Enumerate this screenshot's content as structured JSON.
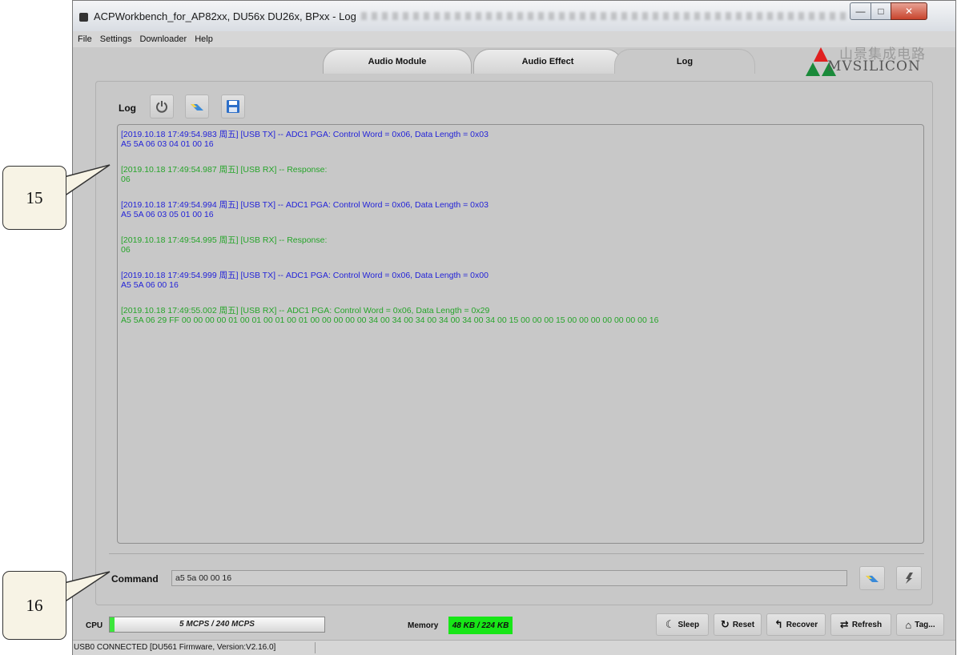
{
  "window": {
    "title": "ACPWorkbench_for_AP82xx, DU56x DU26x, BPxx - Log",
    "controls": {
      "minimize": "—",
      "maximize": "□",
      "close": "✕"
    }
  },
  "menu": [
    "File",
    "Settings",
    "Downloader",
    "Help"
  ],
  "logo": {
    "cn": "山景集成电路",
    "en": "MVSILICON"
  },
  "tabs": {
    "audio_module": "Audio Module",
    "audio_effect": "Audio Effect",
    "log": "Log"
  },
  "log_panel": {
    "label": "Log",
    "entries": [
      {
        "kind": "tx",
        "header": "[2019.10.18 17:49:54.983 周五] [USB TX] -- ADC1 PGA:  Control Word = 0x06,  Data Length = 0x03",
        "data": "A5 5A 06 03 04 01 00 16"
      },
      {
        "kind": "rx",
        "header": "[2019.10.18 17:49:54.987 周五] [USB RX] -- Response:",
        "data": "06"
      },
      {
        "kind": "tx",
        "header": "[2019.10.18 17:49:54.994 周五] [USB TX] -- ADC1 PGA:  Control Word = 0x06,  Data Length = 0x03",
        "data": "A5 5A 06 03 05 01 00 16"
      },
      {
        "kind": "rx",
        "header": "[2019.10.18 17:49:54.995 周五] [USB RX] -- Response:",
        "data": "06"
      },
      {
        "kind": "tx",
        "header": "[2019.10.18 17:49:54.999 周五] [USB TX] -- ADC1 PGA:  Control Word = 0x06,  Data Length = 0x00",
        "data": "A5 5A 06 00 16"
      },
      {
        "kind": "rx",
        "header": "[2019.10.18 17:49:55.002 周五] [USB RX] -- ADC1 PGA:  Control Word = 0x06,  Data Length = 0x29",
        "data": "A5 5A 06 29 FF 00 00 00 00 01 00 01 00 01 00 01 00 00 00 00 00 34 00 34 00 34 00 34 00 34 00 34 00 15 00 00 00 15 00 00 00 00 00 00 00 16"
      }
    ]
  },
  "command": {
    "label": "Command",
    "value": "a5 5a 00 00 16"
  },
  "status": {
    "cpu_label": "CPU",
    "cpu_value": "5 MCPS / 240 MCPS",
    "cpu_fraction": 0.021,
    "memory_label": "Memory",
    "memory_value": "48 KB / 224 KB"
  },
  "buttons": {
    "sleep": "Sleep",
    "reset": "Reset",
    "recover": "Recover",
    "refresh": "Refresh",
    "tag": "Tag..."
  },
  "statusbar": {
    "text": "USB0 CONNECTED [DU561 Firmware, Version:V2.16.0]"
  },
  "callouts": {
    "c15": "15",
    "c16": "16"
  },
  "colors": {
    "tx": "#2323d8",
    "rx": "#26a42a",
    "memory_fill": "#17e617",
    "cpu_fill": "#3ce63c"
  }
}
